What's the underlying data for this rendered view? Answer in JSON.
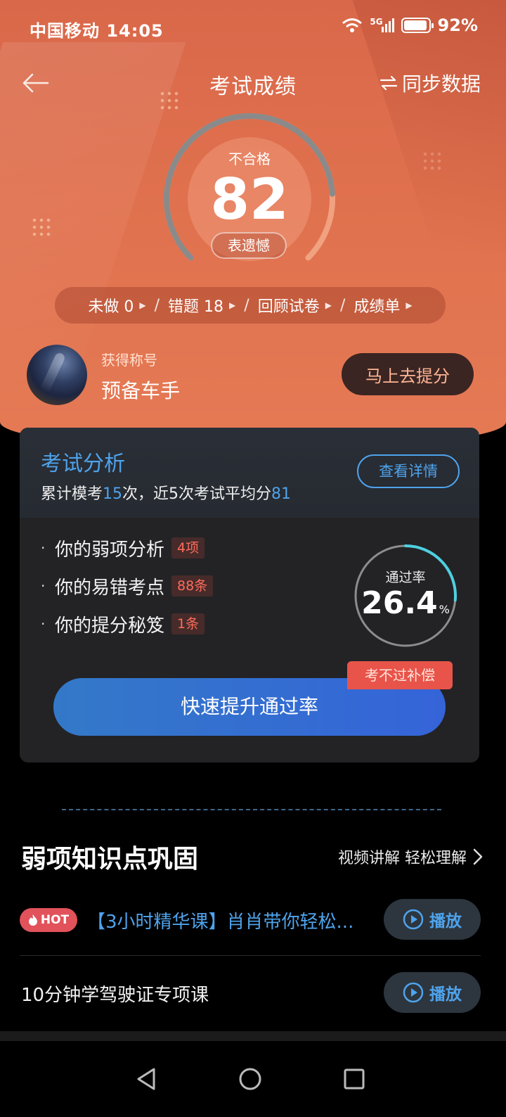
{
  "status_bar": {
    "carrier_time": "中国移动 14:05",
    "network": "5G",
    "battery": "92%"
  },
  "nav": {
    "title": "考试成绩",
    "sync_label": "同步数据"
  },
  "score_gauge": {
    "status": "不合格",
    "score": "82",
    "tag": "表遗憾",
    "fill_fraction": 0.82
  },
  "quick_links": [
    {
      "label": "未做 0"
    },
    {
      "label": "错题 18"
    },
    {
      "label": "回顾试卷"
    },
    {
      "label": "成绩单"
    }
  ],
  "profile": {
    "title_label": "获得称号",
    "title_value": "预备车手",
    "boost_button": "马上去提分"
  },
  "analysis": {
    "title": "考试分析",
    "detail_button": "查看详情",
    "sub_prefix": "累计模考",
    "sub_count": "15",
    "sub_mid": "次，近5次考试平均分",
    "sub_avg": "81",
    "items": [
      {
        "label": "你的弱项分析",
        "badge": "4项"
      },
      {
        "label": "你的易错考点",
        "badge": "88条"
      },
      {
        "label": "你的提分秘笈",
        "badge": "1条"
      }
    ],
    "pass_rate": {
      "label": "通过率",
      "value": "26.4",
      "unit": "%",
      "fraction": 0.264
    },
    "promo_tag": "考不过补偿",
    "cta_button": "快速提升通过率"
  },
  "weak_section": {
    "title": "弱项知识点巩固",
    "more_label": "视频讲解 轻松理解",
    "courses": [
      {
        "hot_label": "HOT",
        "title": "【3小时精华课】肖肖带你轻松...",
        "play_label": "播放"
      },
      {
        "title": "10分钟学驾驶证专项课",
        "play_label": "播放"
      }
    ]
  },
  "colors": {
    "accent_blue": "#4ea3ec",
    "hero_orange": "#e0714e",
    "badge_red": "#ff6c5c",
    "pass_ring": "#4fd0e0"
  }
}
